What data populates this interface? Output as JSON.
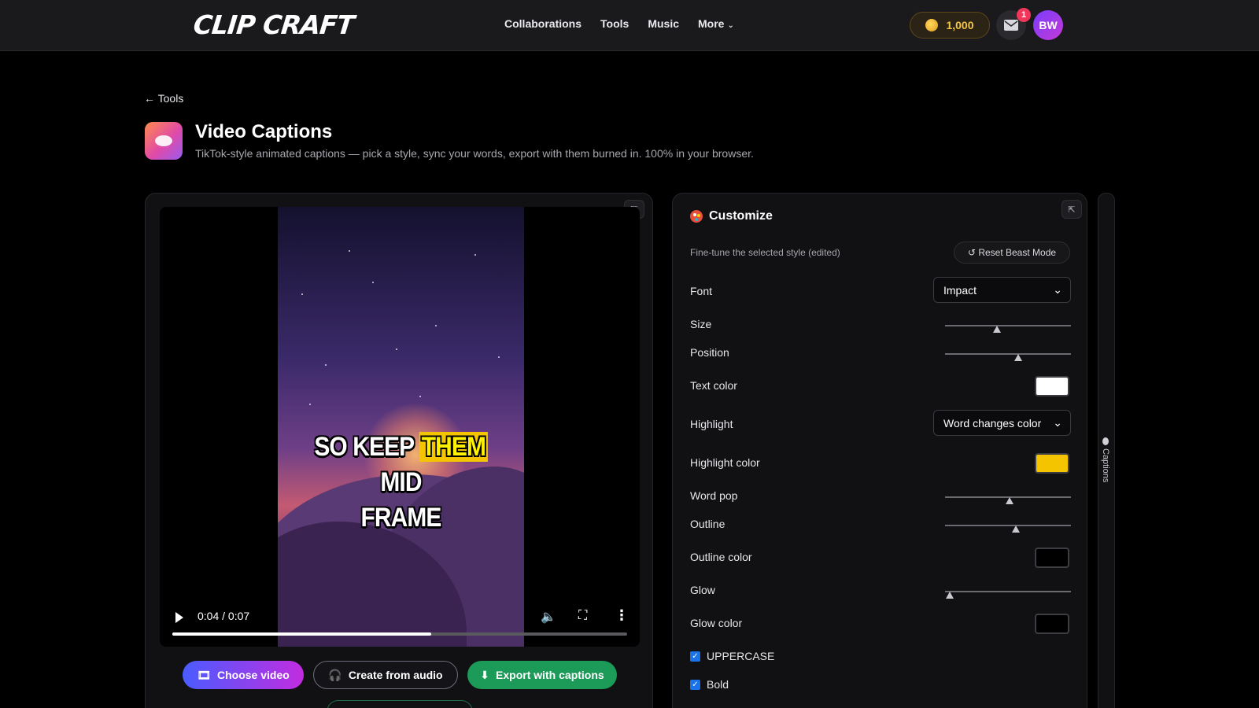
{
  "brand": {
    "logo_text": "CLIP CRAFT"
  },
  "nav": {
    "items": [
      "Collaborations",
      "Tools",
      "Music",
      "More"
    ]
  },
  "account": {
    "coins": "1,000",
    "notifications": "1",
    "initials": "BW"
  },
  "page": {
    "back_label": "← Tools",
    "title": "Video Captions",
    "subtitle": "TikTok-style animated captions — pick a style, sync your words, export with them burned in. 100% in your browser."
  },
  "player": {
    "caption_line1_words": [
      "SO",
      "KEEP",
      "THEM",
      "MID"
    ],
    "caption_highlighted_word": "THEM",
    "caption_line2": "FRAME",
    "time": "0:04 / 0:07",
    "progress": 0.57
  },
  "actions": {
    "choose_video": "Choose video",
    "create_from_audio": "Create from audio",
    "export": "Export with captions"
  },
  "customize": {
    "title": "Customize",
    "hint": "Fine-tune the selected style (edited)",
    "reset_label": "↺ Reset Beast Mode",
    "font_label": "Font",
    "font_value": "Impact",
    "size_label": "Size",
    "size_value": 0.41,
    "position_label": "Position",
    "position_value": 0.58,
    "text_color_label": "Text color",
    "text_color": "#ffffff",
    "highlight_label": "Highlight",
    "highlight_value": "Word changes color",
    "highlight_color_label": "Highlight color",
    "highlight_color": "#f5c400",
    "word_pop_label": "Word pop",
    "word_pop_value": 0.51,
    "outline_label": "Outline",
    "outline_value": 0.56,
    "outline_color_label": "Outline color",
    "outline_color": "#000000",
    "glow_label": "Glow",
    "glow_value": 0.04,
    "glow_color_label": "Glow color",
    "glow_color": "#000000",
    "uppercase_label": "UPPERCASE",
    "uppercase_checked": true,
    "bold_label": "Bold",
    "bold_checked": true
  },
  "side_panel": {
    "label": "Captions"
  },
  "icons": {
    "coin": "coin-icon",
    "mail": "mail-icon",
    "palette": "palette-icon",
    "collapse": "collapse-icon",
    "play": "play-icon",
    "volume": "volume-icon",
    "fullscreen": "fullscreen-icon",
    "more": "more-vertical-icon",
    "headphones": "headphones-icon",
    "download": "download-icon",
    "film": "film-icon"
  }
}
